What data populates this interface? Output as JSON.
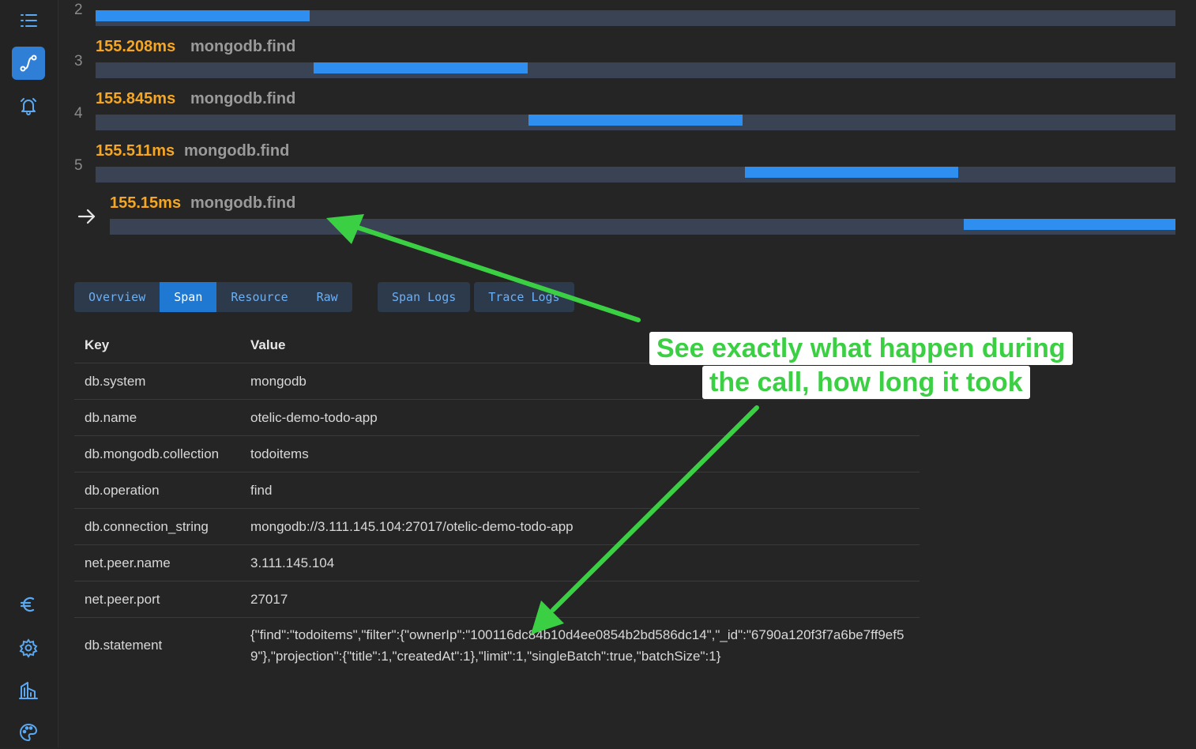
{
  "spans": [
    {
      "row": "2",
      "duration": "",
      "name": "",
      "fill_start": 0.0,
      "fill_end": 0.198
    },
    {
      "row": "3",
      "duration": "155.208ms",
      "name": "mongodb.find",
      "fill_start": 0.202,
      "fill_end": 0.4
    },
    {
      "row": "4",
      "duration": "155.845ms",
      "name": "mongodb.find",
      "fill_start": 0.401,
      "fill_end": 0.599
    },
    {
      "row": "5",
      "duration": "155.511ms",
      "name": "mongodb.find",
      "fill_start": 0.601,
      "fill_end": 0.799
    },
    {
      "row": "",
      "duration": "155.15ms",
      "name": "mongodb.find",
      "fill_start": 0.801,
      "fill_end": 1.0,
      "selected": true
    }
  ],
  "tabs": {
    "overview": "Overview",
    "span": "Span",
    "resource": "Resource",
    "raw": "Raw",
    "span_logs": "Span Logs",
    "trace_logs": "Trace Logs",
    "active": "Span"
  },
  "table": {
    "key_header": "Key",
    "value_header": "Value",
    "rows": [
      {
        "key": "db.system",
        "value": "mongodb"
      },
      {
        "key": "db.name",
        "value": "otelic-demo-todo-app"
      },
      {
        "key": "db.mongodb.collection",
        "value": "todoitems"
      },
      {
        "key": "db.operation",
        "value": "find"
      },
      {
        "key": "db.connection_string",
        "value": "mongodb://3.111.145.104:27017/otelic-demo-todo-app"
      },
      {
        "key": "net.peer.name",
        "value": "3.111.145.104"
      },
      {
        "key": "net.peer.port",
        "value": "27017"
      },
      {
        "key": "db.statement",
        "value": "{\"find\":\"todoitems\",\"filter\":{\"ownerIp\":\"100116dc84b10d4ee0854b2bd586dc14\",\"_id\":\"6790a120f3f7a6be7ff9ef59\"},\"projection\":{\"title\":1,\"createdAt\":1},\"limit\":1,\"singleBatch\":true,\"batchSize\":1}"
      }
    ]
  },
  "callout": {
    "line1": "See exactly what happen during",
    "line2": "the call, how long it took"
  },
  "icons": {
    "sidebar_top": [
      "list-icon",
      "trace-icon",
      "alarm-bell-icon"
    ],
    "sidebar_bottom": [
      "euro-icon",
      "gear-icon",
      "building-icon",
      "palette-icon"
    ],
    "selected_row": "arrow-right-icon"
  },
  "colors": {
    "accent": "#2f8ff0",
    "duration": "#f5a623",
    "callout_text": "#3bd043",
    "track": "#3a4354"
  }
}
